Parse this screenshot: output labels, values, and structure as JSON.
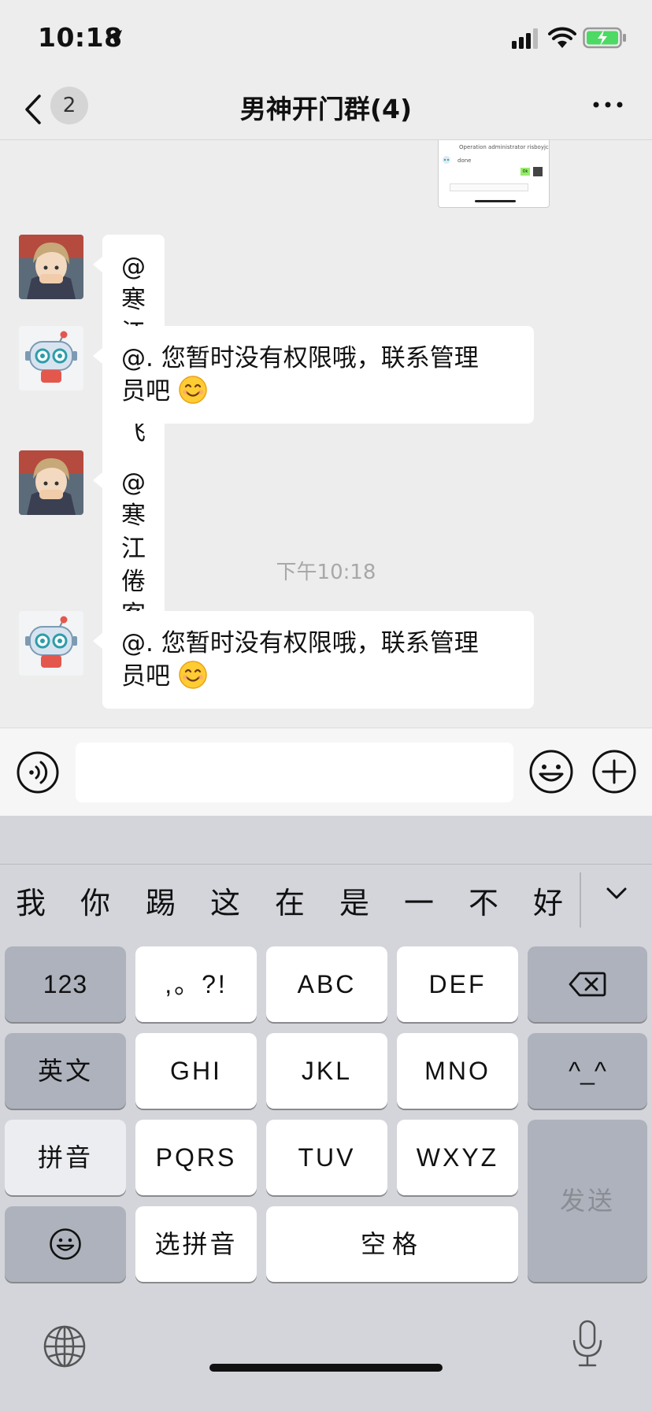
{
  "status_bar": {
    "time": "10:18"
  },
  "nav": {
    "back_badge": "2",
    "title": "男神开门群(4)"
  },
  "thumbnail": {
    "line1": "Operation administrator  risboyjc",
    "line2": "done",
    "ok": "Ok"
  },
  "messages": [
    {
      "sender": "user",
      "lines": [
        "@寒江倦客 飞机"
      ]
    },
    {
      "sender": "bot",
      "lines": [
        "@. 您暂时没有权限哦，联系管理",
        "员吧"
      ],
      "emoji": "smiling-face"
    },
    {
      "sender": "user",
      "lines": [
        "@寒江倦客 踢"
      ]
    },
    {
      "sender": "bot",
      "lines": [
        "@. 您暂时没有权限哦，联系管理",
        "员吧"
      ],
      "emoji": "smiling-face"
    }
  ],
  "time_divider": "下午10:18",
  "input": {
    "placeholder": ""
  },
  "keyboard": {
    "candidates": [
      "我",
      "你",
      "踢",
      "这",
      "在",
      "是",
      "一",
      "不",
      "好"
    ],
    "keys": {
      "num": "123",
      "punct": ",。?!",
      "abc": "ABC",
      "def": "DEF",
      "english": "英文",
      "ghi": "GHI",
      "jkl": "JKL",
      "mno": "MNO",
      "face": "^_^",
      "pinyin": "拼音",
      "pqrs": "PQRS",
      "tuv": "TUV",
      "wxyz": "WXYZ",
      "send": "发送",
      "select_pinyin": "选拼音",
      "space": "空格"
    }
  }
}
